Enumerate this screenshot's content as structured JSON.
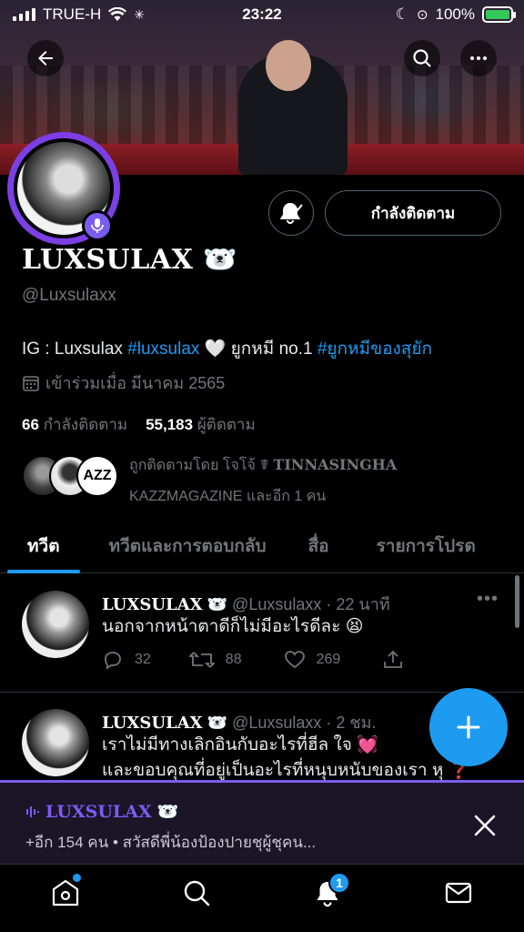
{
  "status_bar": {
    "carrier": "TRUE-H",
    "time": "23:22",
    "battery": "100%"
  },
  "profile": {
    "display_name": "LUXSULAX",
    "handle": "@Luxsulaxx",
    "bio": {
      "text1": "IG : Luxsulax ",
      "tag1": "#luxsulax",
      "text2": " 🤍 ยูกหมี no.1 ",
      "tag2": "#ยูกหมีของสุยัก"
    },
    "joined": "เข้าร่วมเมื่อ มีนาคม 2565",
    "following_count": "66",
    "following_label": "กำลังติดตาม",
    "followers_count": "55,183",
    "followers_label": "ผู้ติดตาม",
    "follow_button": "กำลังติดตาม",
    "followed_by_prefix": "ถูกติดตามโดย โจโจ้ ☤ ",
    "followed_by_name": "TINNASINGHA",
    "followed_by_line2": "KAZZMAGAZINE และอีก 1 คน",
    "emoji": "🐻‍❄️"
  },
  "tabs": [
    {
      "label": "ทวีต",
      "active": true
    },
    {
      "label": "ทวีตและการตอบกลับ",
      "active": false
    },
    {
      "label": "สื่อ",
      "active": false
    },
    {
      "label": "รายการโปรด",
      "active": false
    }
  ],
  "tweets": [
    {
      "name": "LUXSULAX",
      "emoji": "🐻‍❄️",
      "meta": "@Luxsulaxx · 22 นาที",
      "line1": "นอกจากหน้าตาดีก็ไม่มีอะไรดีละ 😫",
      "line2": "",
      "replies": "32",
      "retweets": "88",
      "likes": "269"
    },
    {
      "name": "LUXSULAX",
      "emoji": "🐻‍❄️",
      "meta": "@Luxsulaxx · 2 ชม.",
      "line1": "เราไม่มีทางเลิกอินกับอะไรที่ฮีล ใจ 💓",
      "line2": "และขอบคุณที่อยู่เป็นอะไรที่หนุบหนับของเรา หุ ❓"
    }
  ],
  "space": {
    "host": "LUXSULAX",
    "emoji": "🐻‍❄️",
    "subtitle": "+อีก 154 คน • สวัสดีพี่น้องป้องปายชุผู้ชุคน..."
  },
  "nav": {
    "notifications_badge": "1"
  },
  "colors": {
    "accent": "#1d9bf0",
    "spaces_purple": "#7b5cf0",
    "background": "#000000"
  }
}
